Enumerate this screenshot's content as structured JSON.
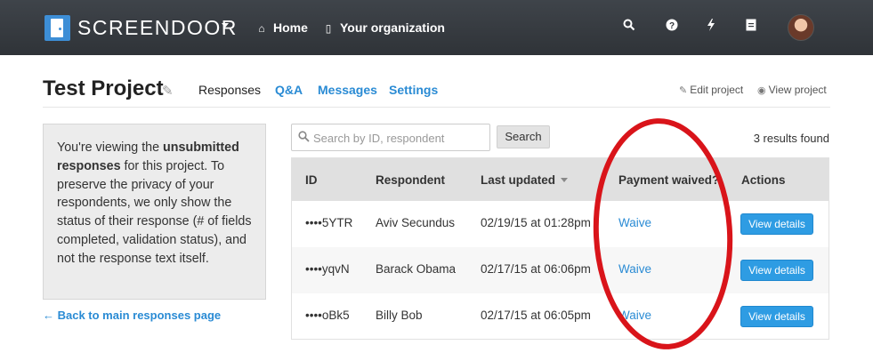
{
  "navbar": {
    "brand": "SCREENDOOR",
    "links": [
      {
        "icon": "home-icon",
        "glyph": "⌂",
        "label": "Home"
      },
      {
        "icon": "building-icon",
        "glyph": "▯",
        "label": "Your organization"
      }
    ],
    "icons": [
      {
        "name": "search-icon",
        "glyph": "🔍"
      },
      {
        "name": "help-icon",
        "glyph": "?"
      },
      {
        "name": "lightning-icon",
        "glyph": "ϟ"
      },
      {
        "name": "document-icon",
        "glyph": "▤"
      }
    ]
  },
  "header": {
    "title": "Test Project",
    "tabs": {
      "responses": "Responses",
      "qa": "Q&A",
      "messages": "Messages",
      "settings": "Settings"
    },
    "edit_project": "Edit project",
    "view_project": "View project"
  },
  "info_box": {
    "text_1": "You're viewing the ",
    "bold": "unsubmitted responses",
    "text_2": " for this project. To preserve the privacy of your respondents, we only show the status of their response (# of fields completed, validation status), and not the response text itself."
  },
  "back_link": "← Back to main responses page",
  "search": {
    "placeholder": "Search by ID, respondent",
    "value": "",
    "button": "Search",
    "results": "3 results found"
  },
  "table": {
    "headers": {
      "id": "ID",
      "respondent": "Respondent",
      "last_updated": "Last updated",
      "payment_waived": "Payment waived?",
      "actions": "Actions"
    },
    "rows": [
      {
        "id": "••••5YTR",
        "respondent": "Aviv Secundus",
        "last_updated": "02/19/15 at 01:28pm",
        "payment": "Waive",
        "action": "View details"
      },
      {
        "id": "••••yqvN",
        "respondent": "Barack Obama",
        "last_updated": "02/17/15 at 06:06pm",
        "payment": "Waive",
        "action": "View details"
      },
      {
        "id": "••••oBk5",
        "respondent": "Billy Bob",
        "last_updated": "02/17/15 at 06:05pm",
        "payment": "Waive",
        "action": "View details"
      }
    ]
  },
  "colors": {
    "navbar": "#33373c",
    "accent": "#2a8bd4",
    "button": "#2e9ce3",
    "annotation": "#d9141a"
  }
}
